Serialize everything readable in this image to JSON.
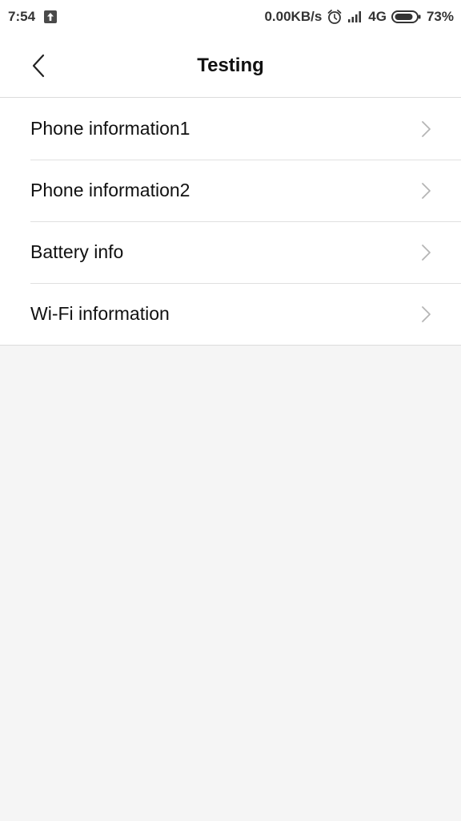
{
  "status_bar": {
    "time": "7:54",
    "net_speed": "0.00KB/s",
    "network_type": "4G",
    "battery": "73%",
    "icons": [
      "upload-icon",
      "alarm-icon",
      "signal-icon",
      "battery-icon"
    ]
  },
  "header": {
    "title": "Testing",
    "back_icon": "chevron-left-icon"
  },
  "list": {
    "items": [
      {
        "label": "Phone information1"
      },
      {
        "label": "Phone information2"
      },
      {
        "label": "Battery info"
      },
      {
        "label": "Wi-Fi information"
      }
    ],
    "item_icon": "chevron-right-icon"
  },
  "colors": {
    "background": "#f5f5f5",
    "surface": "#ffffff",
    "divider": "#e0e0e0",
    "chevron": "#b5b5b5",
    "text": "#111111"
  }
}
